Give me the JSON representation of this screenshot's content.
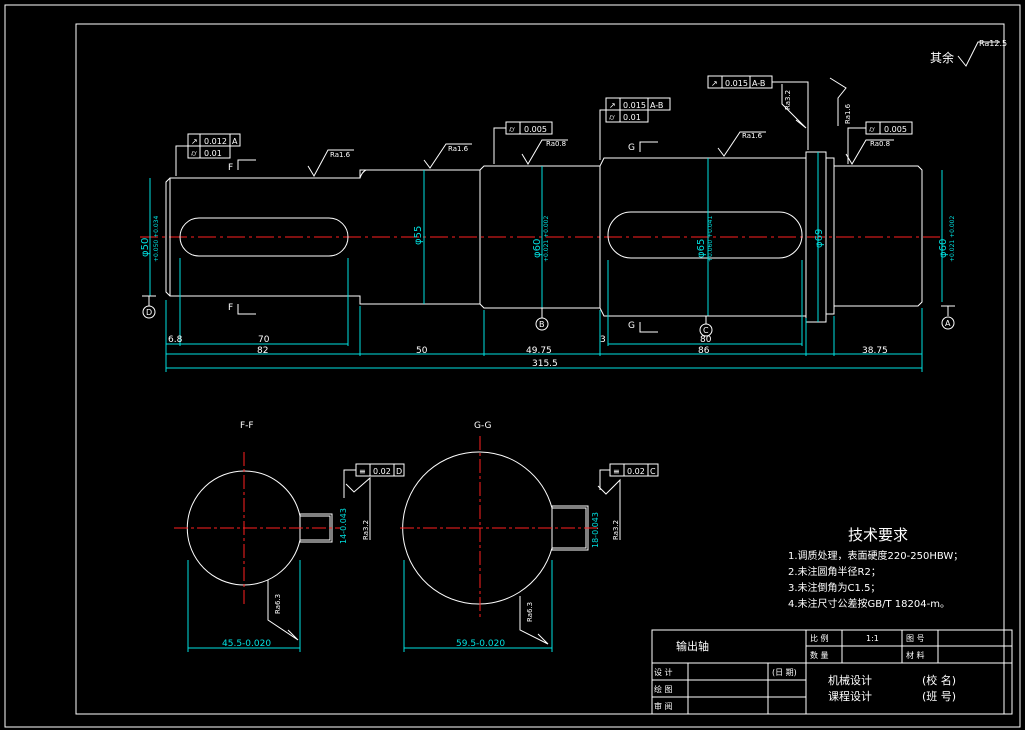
{
  "drawing": {
    "section_views": [
      {
        "title": "F-F",
        "dim_width": "45.5-0.020",
        "dim_keyway": "14-0.043",
        "tol": "0.02",
        "datum": "D",
        "rough": "Ra3.2",
        "rough2": "Ra6.3"
      },
      {
        "title": "G-G",
        "dim_width": "59.5-0.020",
        "dim_keyway": "18-0.043",
        "tol": "0.02",
        "datum": "C",
        "rough": "Ra3.2",
        "rough2": "Ra6.3"
      }
    ],
    "other_roughness_label": "其余",
    "other_roughness": "Ra12.5",
    "section_marks": {
      "f": "F",
      "g": "G"
    },
    "datums": {
      "a": "A",
      "b": "B",
      "c": "C",
      "d": "D"
    },
    "feature_frames": {
      "fcf1_l1": "0.012",
      "fcf1_l1_ref": "A",
      "fcf1_l2": "0.01",
      "fcf2_l1": "0.005",
      "fcf3_l1": "0.015",
      "fcf3_l1_ref": "A-B",
      "fcf3_l2": "0.01",
      "fcf4_l1": "0.015",
      "fcf4_l1_ref": "A-B",
      "fcf5_l1": "0.005"
    },
    "roughness": {
      "r1": "Ra1.6",
      "r2": "Ra1.6",
      "r3": "Ra0.8",
      "r4": "Ra1.6",
      "r5": "Ra3.2",
      "r6": "Ra1.6",
      "r7": "Ra0.8"
    },
    "diameters": {
      "d_left": "φ50",
      "d_left_tol": "+0.050 +0.034",
      "d55": "φ55",
      "d60": "φ60",
      "d60_tol": "+0.021 +0.002",
      "d65": "φ65",
      "d65_tol": "+0.060 +0.041",
      "d69": "φ69",
      "d60r": "φ60",
      "d60r_tol": "+0.021 +0.002"
    },
    "lengths": {
      "l_chamfer": "6.8",
      "l_key1": "70",
      "l_82": "82",
      "l_50": "50",
      "l_4975": "49.75",
      "l_3": "3",
      "l_key2": "80",
      "l_86": "86",
      "l_3875": "38.75",
      "l_total": "315.5"
    }
  },
  "tech_requirements": {
    "title": "技术要求",
    "items": [
      "1.调质处理，表面硬度220-250HBW；",
      "2.未注圆角半径R2；",
      "3.未注倒角为C1.5；",
      "4.未注尺寸公差按GB/T 18204-m。"
    ]
  },
  "title_block": {
    "part_name": "输出轴",
    "scale_label": "比 例",
    "scale_value": "1:1",
    "drawing_no_label": "图 号",
    "quantity_label": "数 量",
    "material_label": "材 料",
    "design_label": "设 计",
    "draw_label": "绘 图",
    "review_label": "审 阅",
    "date_label": "(日 期)",
    "course_line1": "机械设计",
    "course_line2": "课程设计",
    "school": "(校 名)",
    "class": "(班 号)"
  }
}
